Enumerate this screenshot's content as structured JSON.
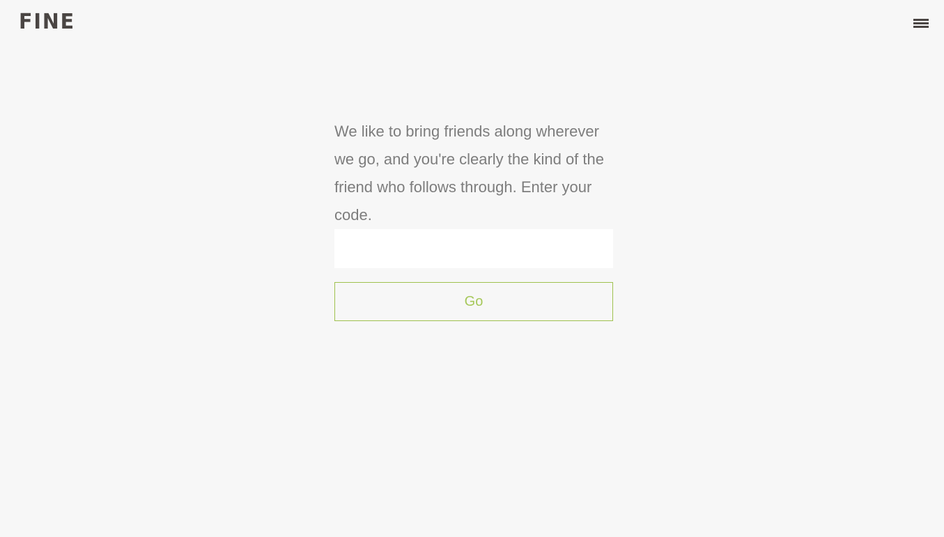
{
  "header": {
    "logo_text": "FINE",
    "menu_icon": "hamburger-menu-icon"
  },
  "main": {
    "message": "We like to bring friends along wherever we go, and you're clearly the kind of the friend who follows through. Enter your code.",
    "code_input": {
      "value": "",
      "placeholder": ""
    },
    "go_label": "Go"
  },
  "colors": {
    "background": "#f7f7f7",
    "logo": "#4a4543",
    "text": "#7d7d7d",
    "accent": "#9fc14e"
  }
}
